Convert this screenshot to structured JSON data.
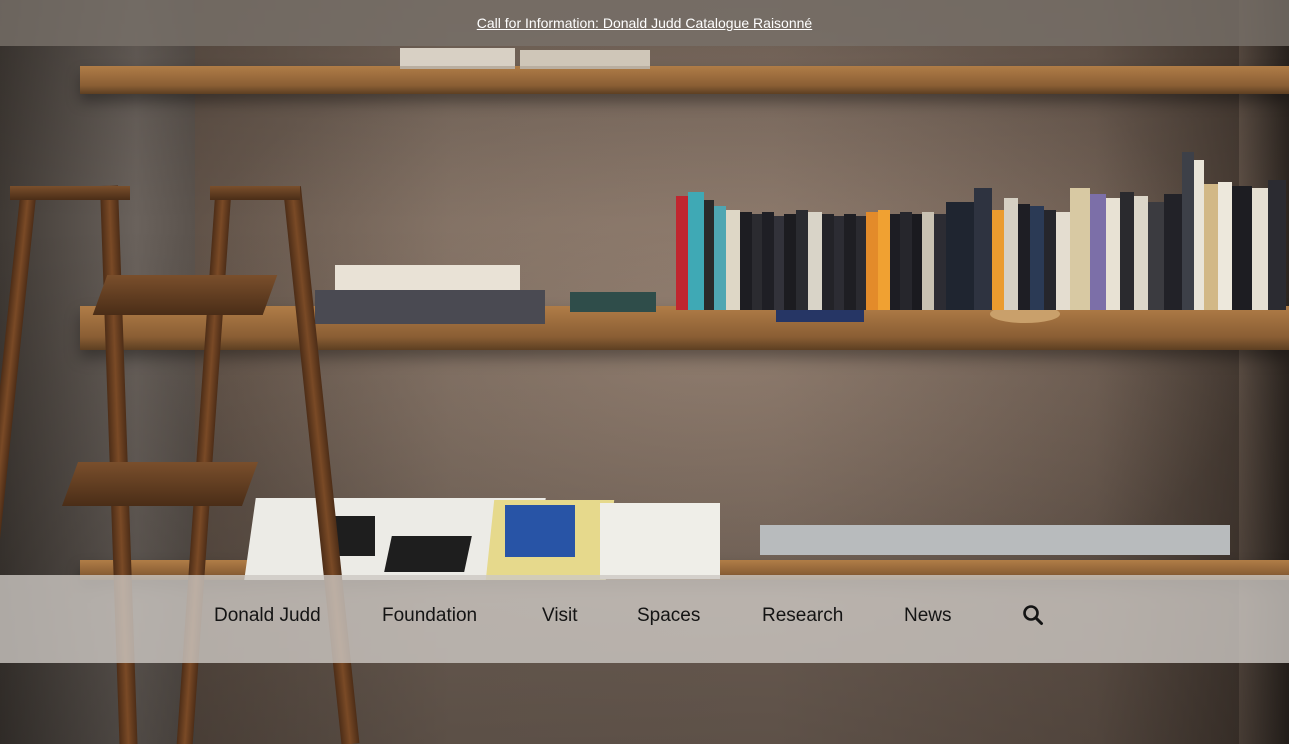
{
  "announcement": {
    "link_text": "Call for Information: Donald Judd Catalogue Raisonné"
  },
  "nav": {
    "items": [
      {
        "label": "Donald Judd"
      },
      {
        "label": "Foundation"
      },
      {
        "label": "Visit"
      },
      {
        "label": "Spaces"
      },
      {
        "label": "Research"
      },
      {
        "label": "News"
      }
    ],
    "search_icon": "search-icon"
  },
  "colors": {
    "announce_bg": "#78706980",
    "nav_bg": "#cdc8c3",
    "nav_text": "#141414",
    "announce_text": "#ffffff"
  }
}
